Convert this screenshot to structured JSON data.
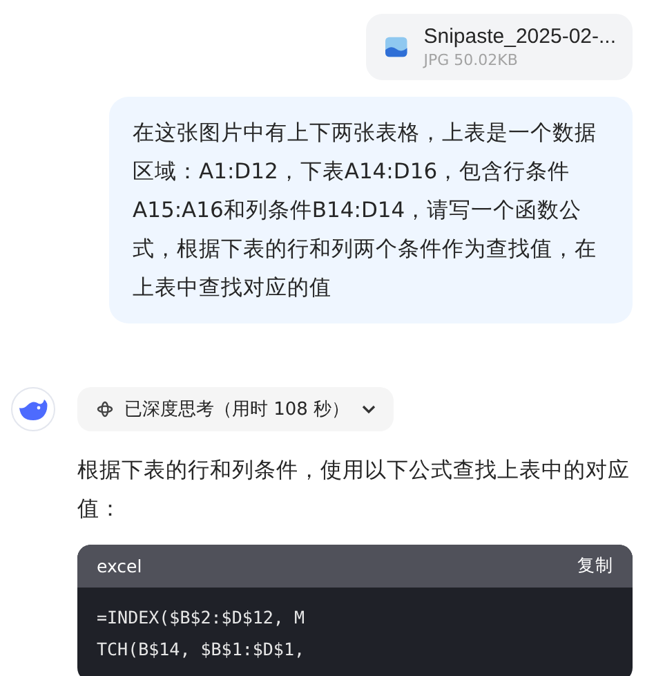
{
  "attachment": {
    "name": "Snipaste_2025-02-...",
    "meta": "JPG 50.02KB"
  },
  "user_message": "在这张图片中有上下两张表格，上表是一个数据区域：A1:D12，下表A14:D16，包含行条件A15:A16和列条件B14:D14，请写一个函数公式，根据下表的行和列两个条件作为查找值，在上表中查找对应的值",
  "thinking": {
    "label": "已深度思考（用时 108 秒）",
    "expanded": false
  },
  "answer": "根据下表的行和列条件，使用以下公式查找上表中的对应值：",
  "code": {
    "language": "excel",
    "copy": "复制",
    "lines": [
      "=INDEX($B$2:$D$12, M",
      "TCH(B$14, $B$1:$D$1,"
    ]
  }
}
